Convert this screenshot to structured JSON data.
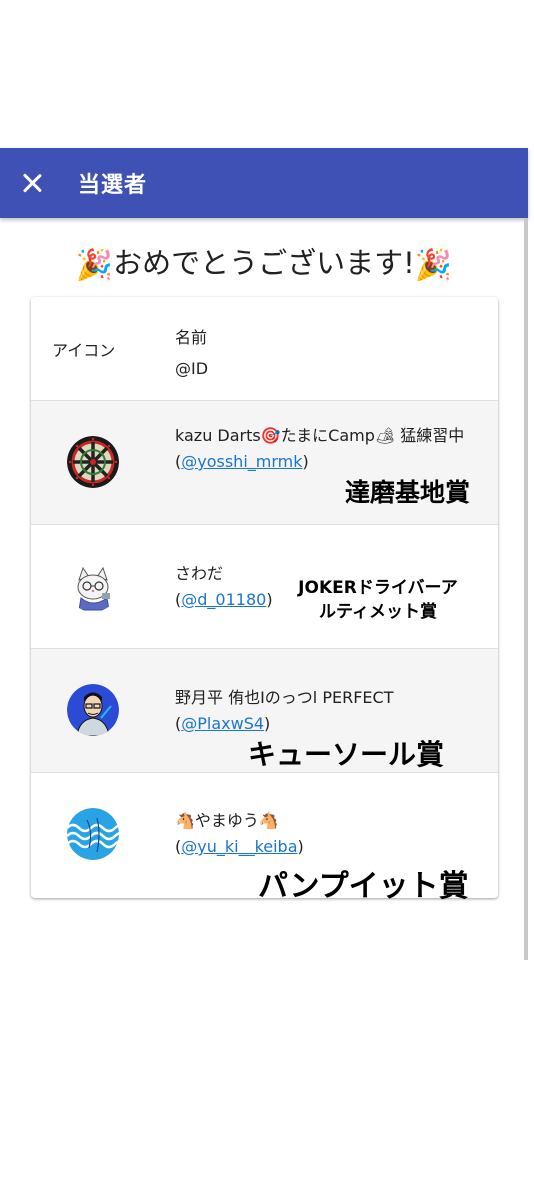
{
  "appbar": {
    "title": "当選者"
  },
  "congrats": {
    "emoji_left": "🎉",
    "text": "おめでとうございます!",
    "emoji_right": "🎉"
  },
  "table": {
    "header": {
      "icon": "アイコン",
      "name": "名前",
      "id": "@ID"
    },
    "rows": [
      {
        "name": "kazu Darts🎯たまにCamp🏕 猛練習中",
        "id": "@yosshi_mrmk",
        "avatar_icon": "dartboard-icon"
      },
      {
        "name": "さわだ",
        "id": "@d_01180",
        "avatar_icon": "cat-character-icon"
      },
      {
        "name": "野月平 侑也Iのっつl PERFECT",
        "id": "@PlaxwS4",
        "avatar_icon": "person-illustration-icon"
      },
      {
        "name": "🐴やまゆう🐴",
        "id": "@yu_ki__keiba",
        "avatar_icon": "wave-pattern-icon"
      }
    ]
  },
  "prizes": {
    "p1": "達磨基地賞",
    "p2_line1": "JOKERドライバーア",
    "p2_line2": "ルティメット賞",
    "p3": "キューソール賞",
    "p4": "パンプイット賞"
  },
  "colors": {
    "appbar": "#3f51b5",
    "link": "#1976d2",
    "row_alt": "#f5f5f5"
  }
}
